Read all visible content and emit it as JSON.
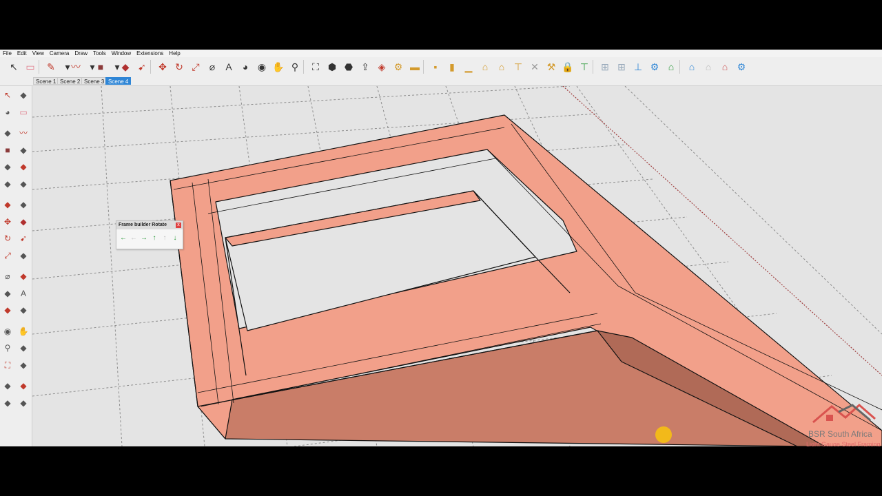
{
  "menu": [
    "File",
    "Edit",
    "View",
    "Camera",
    "Draw",
    "Tools",
    "Window",
    "Extensions",
    "Help"
  ],
  "toolbar_icons": [
    "select-icon",
    "eraser-icon",
    "pencil-icon",
    "dropdown-icon",
    "freehand-icon",
    "dropdown-icon",
    "rectangle-icon",
    "dropdown-icon",
    "push-pull-icon",
    "follow-me-icon",
    "move-icon",
    "rotate-icon",
    "scale-icon",
    "tape-measure-icon",
    "text-icon",
    "paint-bucket-icon",
    "orbit-icon",
    "pan-icon",
    "zoom-icon",
    "zoom-extents-icon",
    "warehouse-icon",
    "extension-warehouse-icon",
    "share-model-icon",
    "ruby-icon",
    "gear-icon",
    "wall-icon",
    "box-icon",
    "column-icon",
    "floor-icon",
    "truss-icon",
    "roof-icon",
    "brace-icon",
    "cross-brace-icon",
    "tool-icon",
    "lock-icon",
    "frame-green-icon",
    "frame-grid-icon",
    "frame-grid-2-icon",
    "frame-tee-icon",
    "settings-icon",
    "roof-truss-icon",
    "roof-truss-2-icon",
    "roof-truss-3-icon",
    "roof-truss-4-icon",
    "settings-icon"
  ],
  "scenes": [
    {
      "label": "Scene 1",
      "active": false
    },
    {
      "label": "Scene 2",
      "active": false
    },
    {
      "label": "Scene 3",
      "active": false
    },
    {
      "label": "Scene 4",
      "active": true
    }
  ],
  "left_tools": [
    "select-icon",
    "component-icon",
    "paint-bucket-icon",
    "eraser-icon",
    "line-icon",
    "freehand-icon",
    "rectangle-icon",
    "rotated-rectangle-icon",
    "circle-icon",
    "polygon-icon",
    "arc-icon",
    "pie-icon",
    "two-point-arc-icon",
    "three-point-arc-icon",
    "move-icon",
    "push-pull-icon",
    "rotate-icon",
    "follow-me-icon",
    "scale-icon",
    "offset-icon",
    "tape-measure-icon",
    "dimension-icon",
    "protractor-icon",
    "text-icon",
    "axes-icon",
    "3d-text-icon",
    "orbit-icon",
    "pan-icon",
    "zoom-icon",
    "zoom-window-icon",
    "zoom-extents-icon",
    "previous-view-icon",
    "position-camera-icon",
    "look-around-icon",
    "walk-icon",
    "section-plane-icon"
  ],
  "panel": {
    "title": "Frame builder Rotate",
    "close": "x",
    "buttons": [
      {
        "name": "rotate-left-icon",
        "glyph": "←",
        "enabled": true
      },
      {
        "name": "rotate-left-alt-icon",
        "glyph": "←",
        "enabled": false
      },
      {
        "name": "rotate-right-icon",
        "glyph": "→",
        "enabled": true
      },
      {
        "name": "rotate-up-icon",
        "glyph": "↑",
        "enabled": true
      },
      {
        "name": "rotate-up-alt-icon",
        "glyph": "↑",
        "enabled": false
      },
      {
        "name": "rotate-down-icon",
        "glyph": "↓",
        "enabled": true
      }
    ]
  },
  "watermark": {
    "title": "BSR South Africa",
    "subtitle": "Light Gauge Steel Framing"
  },
  "colors": {
    "frame": "#f2a08a",
    "frame_side": "#c97d68",
    "grid": "#9a9a9a",
    "accent": "#2f86d6",
    "brand_red": "#d9534f"
  }
}
